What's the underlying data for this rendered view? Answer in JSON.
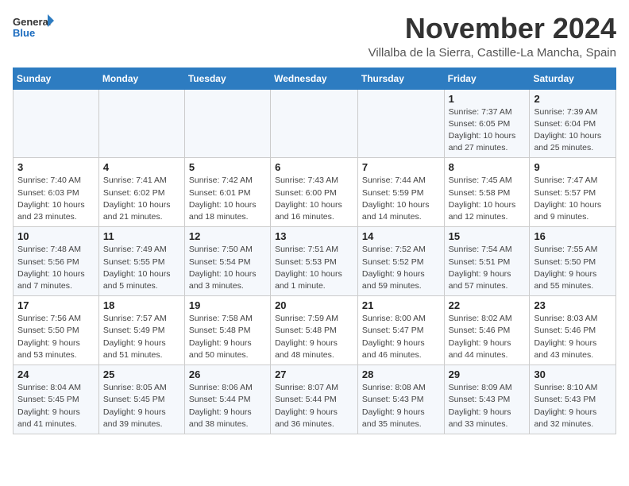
{
  "logo": {
    "general": "General",
    "blue": "Blue"
  },
  "header": {
    "month": "November 2024",
    "location": "Villalba de la Sierra, Castille-La Mancha, Spain"
  },
  "weekdays": [
    "Sunday",
    "Monday",
    "Tuesday",
    "Wednesday",
    "Thursday",
    "Friday",
    "Saturday"
  ],
  "weeks": [
    [
      {
        "day": "",
        "info": ""
      },
      {
        "day": "",
        "info": ""
      },
      {
        "day": "",
        "info": ""
      },
      {
        "day": "",
        "info": ""
      },
      {
        "day": "",
        "info": ""
      },
      {
        "day": "1",
        "info": "Sunrise: 7:37 AM\nSunset: 6:05 PM\nDaylight: 10 hours and 27 minutes."
      },
      {
        "day": "2",
        "info": "Sunrise: 7:39 AM\nSunset: 6:04 PM\nDaylight: 10 hours and 25 minutes."
      }
    ],
    [
      {
        "day": "3",
        "info": "Sunrise: 7:40 AM\nSunset: 6:03 PM\nDaylight: 10 hours and 23 minutes."
      },
      {
        "day": "4",
        "info": "Sunrise: 7:41 AM\nSunset: 6:02 PM\nDaylight: 10 hours and 21 minutes."
      },
      {
        "day": "5",
        "info": "Sunrise: 7:42 AM\nSunset: 6:01 PM\nDaylight: 10 hours and 18 minutes."
      },
      {
        "day": "6",
        "info": "Sunrise: 7:43 AM\nSunset: 6:00 PM\nDaylight: 10 hours and 16 minutes."
      },
      {
        "day": "7",
        "info": "Sunrise: 7:44 AM\nSunset: 5:59 PM\nDaylight: 10 hours and 14 minutes."
      },
      {
        "day": "8",
        "info": "Sunrise: 7:45 AM\nSunset: 5:58 PM\nDaylight: 10 hours and 12 minutes."
      },
      {
        "day": "9",
        "info": "Sunrise: 7:47 AM\nSunset: 5:57 PM\nDaylight: 10 hours and 9 minutes."
      }
    ],
    [
      {
        "day": "10",
        "info": "Sunrise: 7:48 AM\nSunset: 5:56 PM\nDaylight: 10 hours and 7 minutes."
      },
      {
        "day": "11",
        "info": "Sunrise: 7:49 AM\nSunset: 5:55 PM\nDaylight: 10 hours and 5 minutes."
      },
      {
        "day": "12",
        "info": "Sunrise: 7:50 AM\nSunset: 5:54 PM\nDaylight: 10 hours and 3 minutes."
      },
      {
        "day": "13",
        "info": "Sunrise: 7:51 AM\nSunset: 5:53 PM\nDaylight: 10 hours and 1 minute."
      },
      {
        "day": "14",
        "info": "Sunrise: 7:52 AM\nSunset: 5:52 PM\nDaylight: 9 hours and 59 minutes."
      },
      {
        "day": "15",
        "info": "Sunrise: 7:54 AM\nSunset: 5:51 PM\nDaylight: 9 hours and 57 minutes."
      },
      {
        "day": "16",
        "info": "Sunrise: 7:55 AM\nSunset: 5:50 PM\nDaylight: 9 hours and 55 minutes."
      }
    ],
    [
      {
        "day": "17",
        "info": "Sunrise: 7:56 AM\nSunset: 5:50 PM\nDaylight: 9 hours and 53 minutes."
      },
      {
        "day": "18",
        "info": "Sunrise: 7:57 AM\nSunset: 5:49 PM\nDaylight: 9 hours and 51 minutes."
      },
      {
        "day": "19",
        "info": "Sunrise: 7:58 AM\nSunset: 5:48 PM\nDaylight: 9 hours and 50 minutes."
      },
      {
        "day": "20",
        "info": "Sunrise: 7:59 AM\nSunset: 5:48 PM\nDaylight: 9 hours and 48 minutes."
      },
      {
        "day": "21",
        "info": "Sunrise: 8:00 AM\nSunset: 5:47 PM\nDaylight: 9 hours and 46 minutes."
      },
      {
        "day": "22",
        "info": "Sunrise: 8:02 AM\nSunset: 5:46 PM\nDaylight: 9 hours and 44 minutes."
      },
      {
        "day": "23",
        "info": "Sunrise: 8:03 AM\nSunset: 5:46 PM\nDaylight: 9 hours and 43 minutes."
      }
    ],
    [
      {
        "day": "24",
        "info": "Sunrise: 8:04 AM\nSunset: 5:45 PM\nDaylight: 9 hours and 41 minutes."
      },
      {
        "day": "25",
        "info": "Sunrise: 8:05 AM\nSunset: 5:45 PM\nDaylight: 9 hours and 39 minutes."
      },
      {
        "day": "26",
        "info": "Sunrise: 8:06 AM\nSunset: 5:44 PM\nDaylight: 9 hours and 38 minutes."
      },
      {
        "day": "27",
        "info": "Sunrise: 8:07 AM\nSunset: 5:44 PM\nDaylight: 9 hours and 36 minutes."
      },
      {
        "day": "28",
        "info": "Sunrise: 8:08 AM\nSunset: 5:43 PM\nDaylight: 9 hours and 35 minutes."
      },
      {
        "day": "29",
        "info": "Sunrise: 8:09 AM\nSunset: 5:43 PM\nDaylight: 9 hours and 33 minutes."
      },
      {
        "day": "30",
        "info": "Sunrise: 8:10 AM\nSunset: 5:43 PM\nDaylight: 9 hours and 32 minutes."
      }
    ]
  ]
}
